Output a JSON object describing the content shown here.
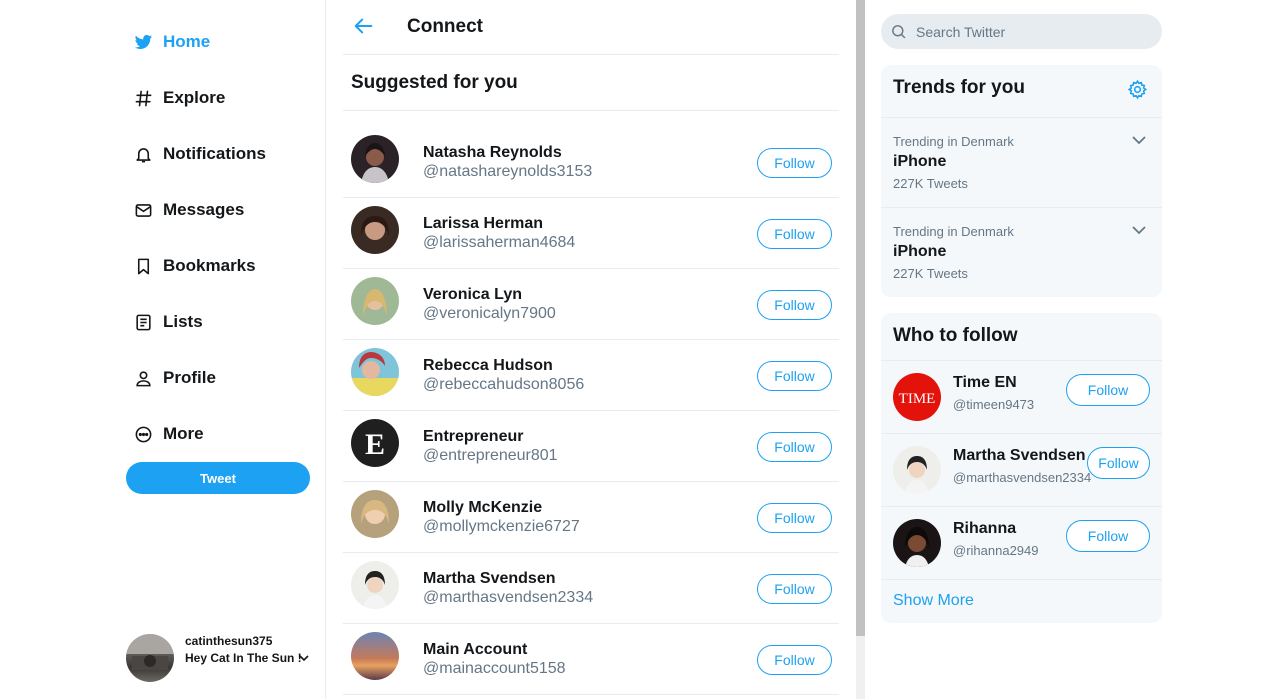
{
  "nav": {
    "items": [
      {
        "label": "Home",
        "icon": "twitter-bird-icon"
      },
      {
        "label": "Explore",
        "icon": "hashtag-icon"
      },
      {
        "label": "Notifications",
        "icon": "bell-icon"
      },
      {
        "label": "Messages",
        "icon": "envelope-icon"
      },
      {
        "label": "Bookmarks",
        "icon": "bookmark-icon"
      },
      {
        "label": "Lists",
        "icon": "list-icon"
      },
      {
        "label": "Profile",
        "icon": "person-icon"
      },
      {
        "label": "More",
        "icon": "more-dots-icon"
      }
    ],
    "tweet_label": "Tweet"
  },
  "account": {
    "handle": "catinthesun375",
    "name": "Hey Cat In The Sun !"
  },
  "center": {
    "title": "Connect",
    "section_title": "Suggested for you",
    "follow_label": "Follow",
    "users": [
      {
        "name": "Natasha Reynolds",
        "handle": "@natashareynolds3153"
      },
      {
        "name": "Larissa Herman",
        "handle": "@larissaherman4684"
      },
      {
        "name": "Veronica Lyn",
        "handle": "@veronicalyn7900"
      },
      {
        "name": "Rebecca Hudson",
        "handle": "@rebeccahudson8056"
      },
      {
        "name": "Entrepreneur",
        "handle": "@entrepreneur801"
      },
      {
        "name": "Molly McKenzie",
        "handle": "@mollymckenzie6727"
      },
      {
        "name": "Martha Svendsen",
        "handle": "@marthasvendsen2334"
      },
      {
        "name": "Main Account",
        "handle": "@mainaccount5158"
      }
    ]
  },
  "search": {
    "placeholder": "Search Twitter"
  },
  "trends": {
    "title": "Trends for you",
    "items": [
      {
        "context": "Trending in Denmark",
        "name": "iPhone",
        "count": "227K Tweets"
      },
      {
        "context": "Trending in Denmark",
        "name": "iPhone",
        "count": "227K Tweets"
      }
    ]
  },
  "who_to_follow": {
    "title": "Who to follow",
    "follow_label": "Follow",
    "users": [
      {
        "name": "Time EN",
        "handle": "@timeen9473",
        "logo_text": "TIME"
      },
      {
        "name": "Martha Svendsen",
        "handle": "@marthasvendsen2334"
      },
      {
        "name": "Rihanna",
        "handle": "@rihanna2949"
      }
    ],
    "show_more": "Show More"
  },
  "colors": {
    "accent": "#1da1f2",
    "text": "#14171a",
    "secondary": "#657786",
    "panel": "#f5f8fa"
  }
}
